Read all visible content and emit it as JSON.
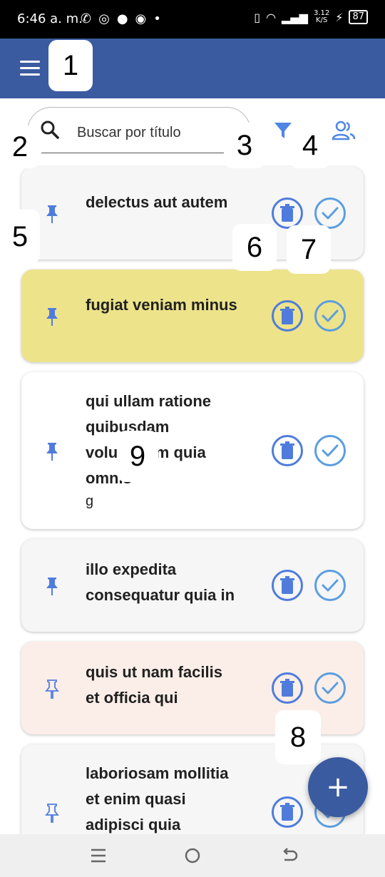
{
  "status_bar": {
    "time": "6:46 a. m.",
    "net_speed_value": "3.12",
    "net_speed_unit": "K/S",
    "battery": "87"
  },
  "app_bar": {
    "menu_icon": "hamburger-menu-icon"
  },
  "search": {
    "placeholder": "Buscar por título",
    "value": ""
  },
  "toolbar": {
    "filter_icon": "filter-icon",
    "users_icon": "users-icon"
  },
  "colors": {
    "app_bar": "#3b5ba0",
    "accent_blue": "#4f7cdc",
    "card_gray": "#f6f6f6",
    "card_yellow": "#ede38a",
    "card_white": "#ffffff",
    "card_peach": "#fbeee8",
    "nav_bar": "#efefef"
  },
  "tasks": [
    {
      "title": "delectus aut autem",
      "subtitle": "",
      "pinned": true,
      "color": "#f6f6f6"
    },
    {
      "title": "fugiat veniam minus",
      "subtitle": "",
      "pinned": true,
      "color": "#ede38a"
    },
    {
      "title": "qui ullam ratione\nquibusdam\nvoluptatem quia\nomnis",
      "subtitle": "g",
      "pinned": true,
      "color": "#ffffff"
    },
    {
      "title": "illo expedita\nconsequatur quia in",
      "subtitle": "",
      "pinned": true,
      "color": "#f6f6f6"
    },
    {
      "title": "quis ut nam facilis\net officia qui",
      "subtitle": "",
      "pinned": false,
      "color": "#fbeee8"
    },
    {
      "title": "laboriosam mollitia\net enim quasi\nadipisci quia",
      "subtitle": "",
      "pinned": false,
      "color": "#f6f6f6"
    }
  ],
  "annotations": [
    "1",
    "2",
    "3",
    "4",
    "5",
    "6",
    "7",
    "8",
    "9"
  ],
  "fab": {
    "label": "+"
  },
  "nav": {
    "recents_icon": "recents-icon",
    "home_icon": "home-icon",
    "back_icon": "back-icon"
  }
}
